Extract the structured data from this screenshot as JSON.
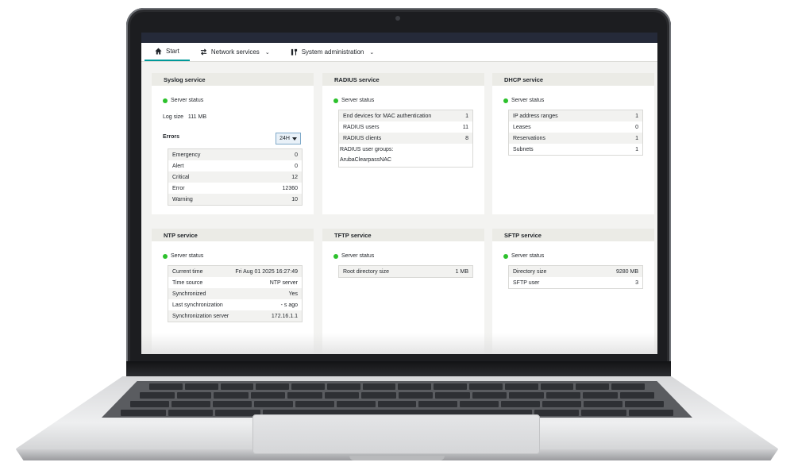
{
  "nav": {
    "start": "Start",
    "network_services": "Network services",
    "system_administration": "System administration"
  },
  "syslog": {
    "title": "Syslog service",
    "status": "Server status",
    "log_size_label": "Log size",
    "log_size_value": "111 MB",
    "errors_label": "Errors",
    "period": "24H",
    "rows": [
      {
        "k": "Emergency",
        "v": "0"
      },
      {
        "k": "Alert",
        "v": "0"
      },
      {
        "k": "Critical",
        "v": "12"
      },
      {
        "k": "Error",
        "v": "12360"
      },
      {
        "k": "Warning",
        "v": "10"
      }
    ]
  },
  "radius": {
    "title": "RADIUS service",
    "status": "Server status",
    "rows": [
      {
        "k": "End devices for MAC authentication",
        "v": "1"
      },
      {
        "k": "RADIUS users",
        "v": "11"
      },
      {
        "k": "RADIUS clients",
        "v": "8"
      }
    ],
    "groups_label": "RADIUS user groups:",
    "groups_value": "ArubaClearpassNAC"
  },
  "dhcp": {
    "title": "DHCP service",
    "status": "Server status",
    "rows": [
      {
        "k": "IP address ranges",
        "v": "1"
      },
      {
        "k": "Leases",
        "v": "0"
      },
      {
        "k": "Reservations",
        "v": "1"
      },
      {
        "k": "Subnets",
        "v": "1"
      }
    ]
  },
  "ntp": {
    "title": "NTP service",
    "status": "Server status",
    "rows": [
      {
        "k": "Current time",
        "v": "Fri Aug 01 2025 16:27:49"
      },
      {
        "k": "Time source",
        "v": "NTP server"
      },
      {
        "k": "Synchronized",
        "v": "Yes"
      },
      {
        "k": "Last synchronization",
        "v": "- s ago"
      },
      {
        "k": "Synchronization server",
        "v": "172.16.1.1"
      }
    ]
  },
  "tftp": {
    "title": "TFTP service",
    "status": "Server status",
    "rows": [
      {
        "k": "Root directory size",
        "v": "1 MB"
      }
    ]
  },
  "sftp": {
    "title": "SFTP service",
    "status": "Server status",
    "rows": [
      {
        "k": "Directory size",
        "v": "9280 MB"
      },
      {
        "k": "SFTP user",
        "v": "3"
      }
    ]
  },
  "colors": {
    "status_ok": "#2cc12c",
    "active_tab": "#009999",
    "title_bar": "#252a39"
  },
  "icons": {
    "start": "home-icon",
    "network_services": "arrows-exchange-icon",
    "system_administration": "tools-icon"
  }
}
